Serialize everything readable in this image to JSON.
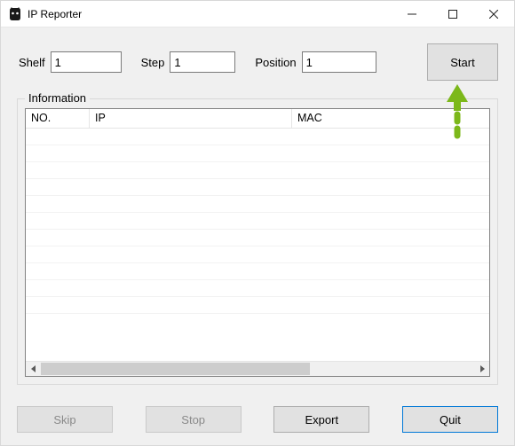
{
  "window": {
    "title": "IP Reporter"
  },
  "inputs": {
    "shelf_label": "Shelf",
    "shelf_value": "1",
    "step_label": "Step",
    "step_value": "1",
    "position_label": "Position",
    "position_value": "1"
  },
  "buttons": {
    "start": "Start",
    "skip": "Skip",
    "stop": "Stop",
    "export": "Export",
    "quit": "Quit"
  },
  "group": {
    "legend": "Information",
    "columns": {
      "no": "NO.",
      "ip": "IP",
      "mac": "MAC"
    }
  },
  "colors": {
    "annotation": "#7cb81a"
  }
}
